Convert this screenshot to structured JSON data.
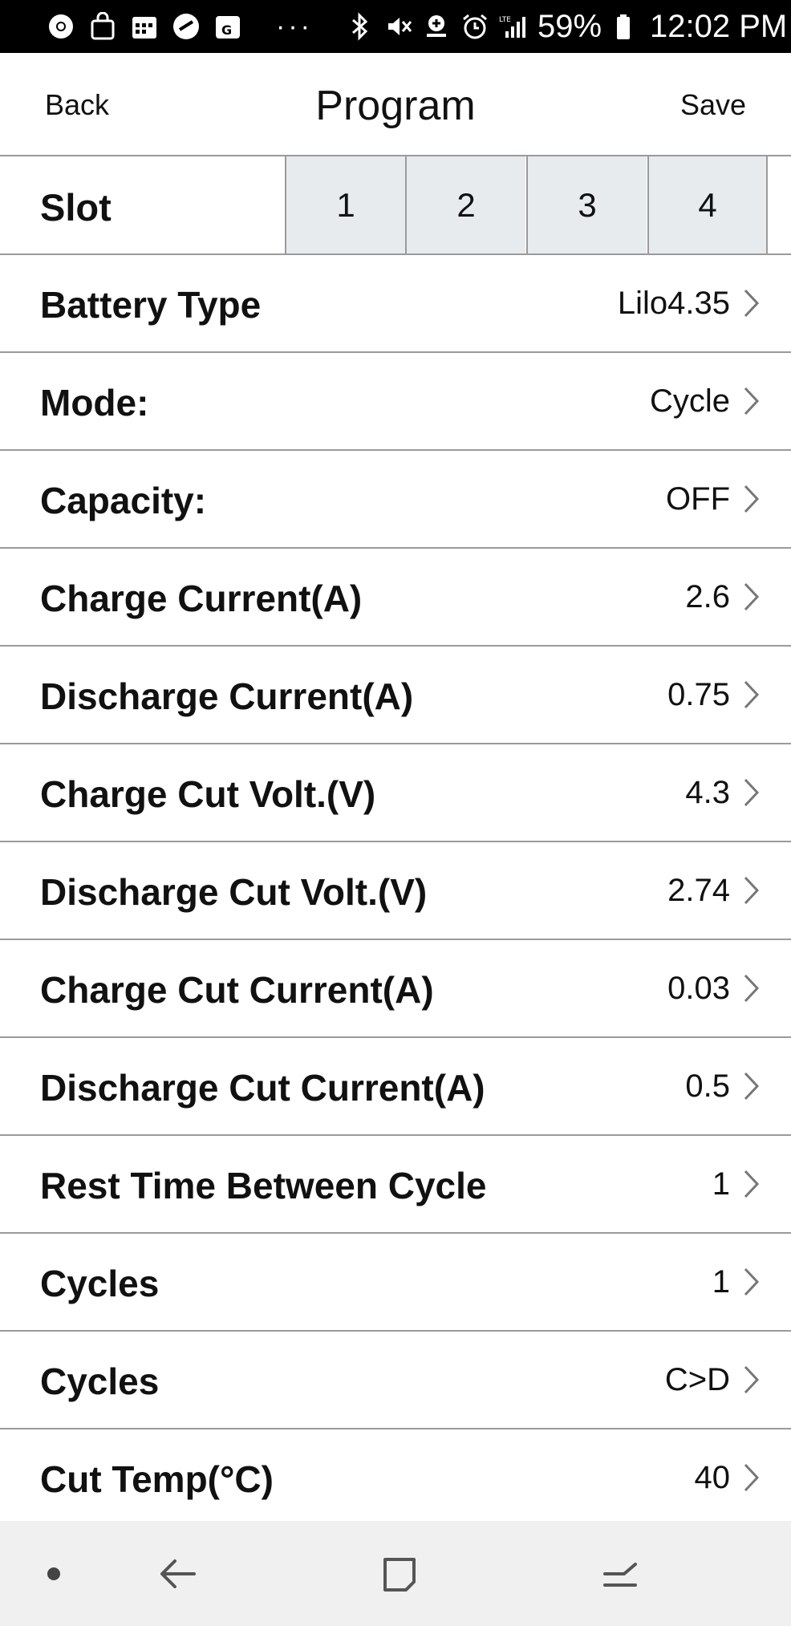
{
  "status_bar": {
    "battery_percent": "59%",
    "time": "12:02 PM",
    "more": "···",
    "icons_left": [
      "chrome-icon",
      "shopping-bag-icon",
      "calendar-icon",
      "app-icon",
      "maps-icon"
    ],
    "icons_right": [
      "bluetooth-icon",
      "mute-icon",
      "data-saver-icon",
      "alarm-icon",
      "lte-signal-icon",
      "battery-icon"
    ]
  },
  "header": {
    "back_label": "Back",
    "title": "Program",
    "save_label": "Save"
  },
  "slot": {
    "label": "Slot",
    "options": [
      "1",
      "2",
      "3",
      "4"
    ]
  },
  "settings": [
    {
      "label": "Battery Type",
      "value": "Lilo4.35"
    },
    {
      "label": "Mode:",
      "value": "Cycle"
    },
    {
      "label": "Capacity:",
      "value": "OFF"
    },
    {
      "label": "Charge Current(A)",
      "value": "2.6"
    },
    {
      "label": "Discharge Current(A)",
      "value": "0.75"
    },
    {
      "label": "Charge Cut Volt.(V)",
      "value": "4.3"
    },
    {
      "label": "Discharge Cut Volt.(V)",
      "value": "2.74"
    },
    {
      "label": "Charge Cut Current(A)",
      "value": "0.03"
    },
    {
      "label": "Discharge Cut Current(A)",
      "value": "0.5"
    },
    {
      "label": "Rest Time Between Cycle",
      "value": "1"
    },
    {
      "label": "Cycles",
      "value": "1"
    },
    {
      "label": "Cycles",
      "value": "C>D"
    },
    {
      "label": "Cut Temp(°C)",
      "value": "40"
    }
  ],
  "nav_bar": {
    "icons": [
      "nav-dot-icon",
      "back-arrow-icon",
      "home-square-icon",
      "recents-icon"
    ]
  }
}
